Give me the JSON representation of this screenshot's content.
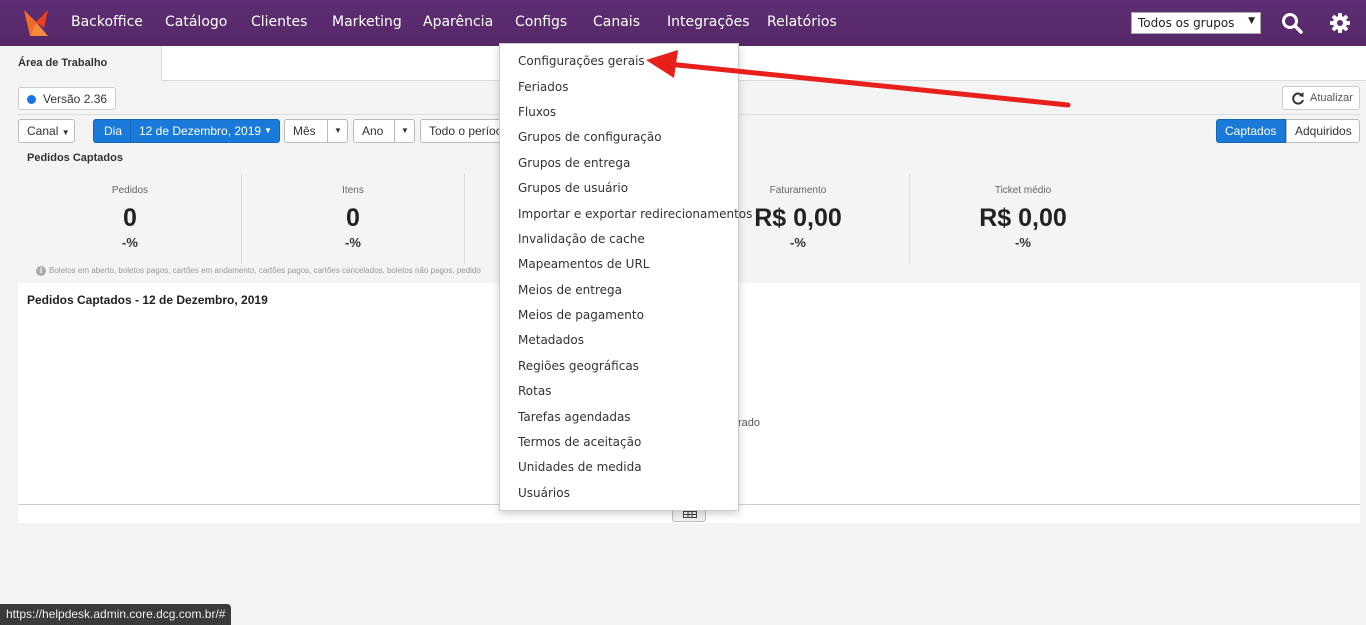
{
  "nav": {
    "items": [
      "Backoffice",
      "Catálogo",
      "Clientes",
      "Marketing",
      "Aparência",
      "Configs",
      "Canais",
      "Integrações",
      "Relatórios"
    ],
    "group_select": "Todos os grupos",
    "icons": [
      "search-icon",
      "gear-icon"
    ],
    "bg_color": "#5b2c6f"
  },
  "tabs": {
    "active": "Área de Trabalho"
  },
  "version": "Versão 2.36",
  "refresh_label": "Atualizar",
  "filters": {
    "canal": "Canal",
    "dia": "Dia",
    "date": "12 de Dezembro, 2019",
    "mes": "Mês",
    "ano": "Ano",
    "todo_periodo": "Todo o períoc",
    "captados": "Captados",
    "adquiridos": "Adquiridos"
  },
  "section_title": "Pedidos Captados",
  "stats": [
    {
      "label": "Pedidos",
      "value": "0",
      "pct": "-%"
    },
    {
      "label": "Itens",
      "value": "0",
      "pct": "-%"
    },
    {
      "label": "Faturamento",
      "value": "R$ 0,00",
      "pct": "-%"
    },
    {
      "label": "Ticket médio",
      "value": "R$ 0,00",
      "pct": "-%"
    }
  ],
  "footnote": "Boletos em aberto, boletos pagos, cartões em andamento, cartões pagos, cartões cancelados, boletos não pagos, pedido",
  "panel": {
    "title": "Pedidos Captados - 12 de Dezembro, 2019",
    "message": "rado"
  },
  "menu": [
    "Configurações gerais",
    "Feriados",
    "Fluxos",
    "Grupos de configuração",
    "Grupos de entrega",
    "Grupos de usuário",
    "Importar e exportar redirecionamentos",
    "Invalidação de cache",
    "Mapeamentos de URL",
    "Meios de entrega",
    "Meios de pagamento",
    "Metadados",
    "Regiões geográficas",
    "Rotas",
    "Tarefas agendadas",
    "Termos de aceitação",
    "Unidades de medida",
    "Usuários"
  ],
  "status_url": "https://helpdesk.admin.core.dcg.com.br/#",
  "accent": "#1a7ad9",
  "annotation_arrow_color": "#e8201c"
}
